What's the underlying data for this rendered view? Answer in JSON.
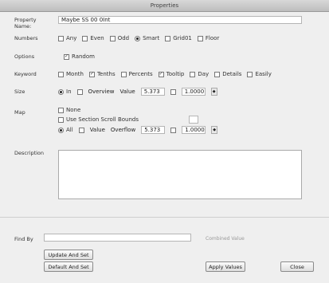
{
  "window": {
    "title": "Properties"
  },
  "fields": {
    "name_label": "Property Name:",
    "name_value": "Maybe SS 00 0Int",
    "numbers_label": "Numbers",
    "numbers_opts": [
      "Any",
      "Even",
      "Odd",
      "Smart",
      "Grid01",
      "Floor"
    ],
    "options_label": "Options",
    "options_opt": "Random",
    "keyword_label": "Keyword",
    "keyword_opts": [
      "Month",
      "Tenths",
      "Percents",
      "Tooltip",
      "Day",
      "Details",
      "Easily"
    ],
    "size_label": "Size",
    "size_opt": "In",
    "size_text1": "Overview",
    "size_text2": "Value",
    "size_v1": "5.373",
    "size_v2": "1.0000",
    "map_label": "Map",
    "map_opt1": "None",
    "map_opt2": "Use Section Scroll Bounds",
    "map_opt3": "All",
    "map_text1": "Value",
    "map_text2": "Overflow",
    "map_v1": "5.373",
    "map_v2": "1.0000",
    "desc_label": "Description"
  },
  "bottom": {
    "find_label": "Find By",
    "combo_label": "Combined Value",
    "btn_save": "Update And Set",
    "btn_load": "Default And Set",
    "btn_apply": "Apply Values",
    "btn_close": "Close"
  }
}
